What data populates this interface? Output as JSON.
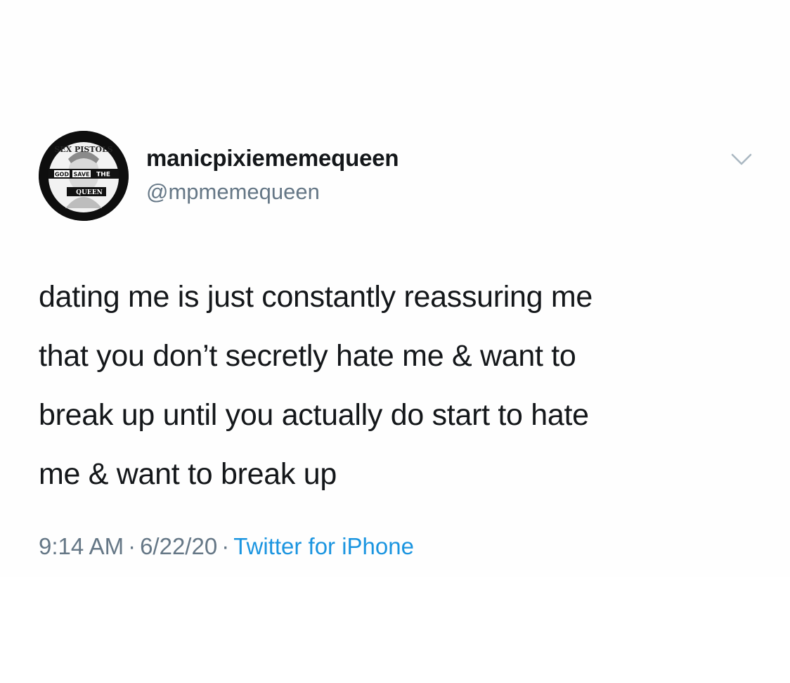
{
  "tweet": {
    "author": {
      "display_name": "manicpixiememequeen",
      "handle": "@mpmemequeen",
      "avatar_icon": "sex-pistols-god-save-the-queen-icon",
      "avatar_text": {
        "top": "SEX PISTOLS",
        "left": "GOD",
        "middle": "SAVE",
        "right": "THE",
        "bottom": "QUEEN"
      }
    },
    "text_lines": [
      "dating me is just constantly reassuring me",
      "that you don’t secretly hate me & want to",
      "break up until you actually do start to hate",
      "me & want to break up"
    ],
    "meta": {
      "time": "9:14 AM",
      "separator": "·",
      "date": "6/22/20",
      "source": "Twitter for iPhone"
    },
    "menu_icon": "chevron-down-icon"
  },
  "colors": {
    "text_primary": "#14171a",
    "text_secondary": "#657786",
    "link": "#1b95e0",
    "chevron": "#aab8c2",
    "background": "#ffffff"
  }
}
